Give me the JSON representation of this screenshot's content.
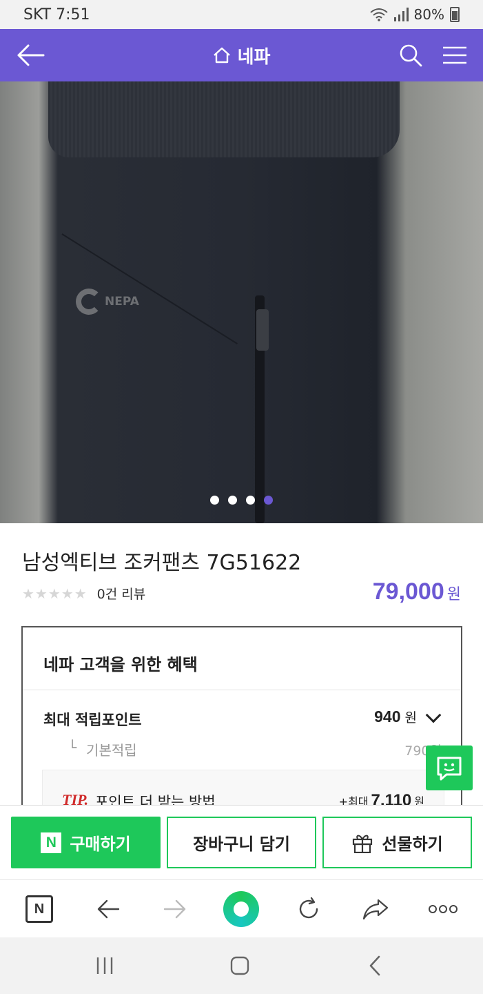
{
  "status_bar": {
    "carrier": "SKT",
    "time": "7:51",
    "battery": "80%"
  },
  "header": {
    "title": "네파",
    "colors": {
      "accent": "#6b58d3"
    }
  },
  "gallery": {
    "total_images": 4,
    "active_index": 4
  },
  "product": {
    "name": "남성엑티브 조커팬츠 7G51622",
    "review_count": "0건 리뷰",
    "rating": 0,
    "price": "79,000",
    "price_unit": "원"
  },
  "benefits": {
    "title": "네파 고객을 위한 혜택",
    "max_points_label": "최대 적립포인트",
    "max_points_value": "940",
    "unit": "원",
    "basic_label": "기본적립",
    "basic_value": "790원",
    "tip_label": "TIP.",
    "tip_text": "포인트 더 받는 방법",
    "tip_prefix": "+최대",
    "tip_value": "7,110",
    "tip_unit": "원"
  },
  "actions": {
    "buy_badge": "N",
    "buy_label": "구매하기",
    "cart_label": "장바구니 담기",
    "gift_label": "선물하기"
  },
  "browser_bar": {
    "home_badge": "N"
  },
  "icons": [
    "back-arrow-icon",
    "home-icon",
    "search-icon",
    "menu-icon",
    "chat-icon",
    "gift-icon",
    "forward-arrow-icon",
    "refresh-icon",
    "share-icon",
    "more-icon",
    "recent-apps-icon",
    "home-circle-icon",
    "system-back-icon"
  ]
}
